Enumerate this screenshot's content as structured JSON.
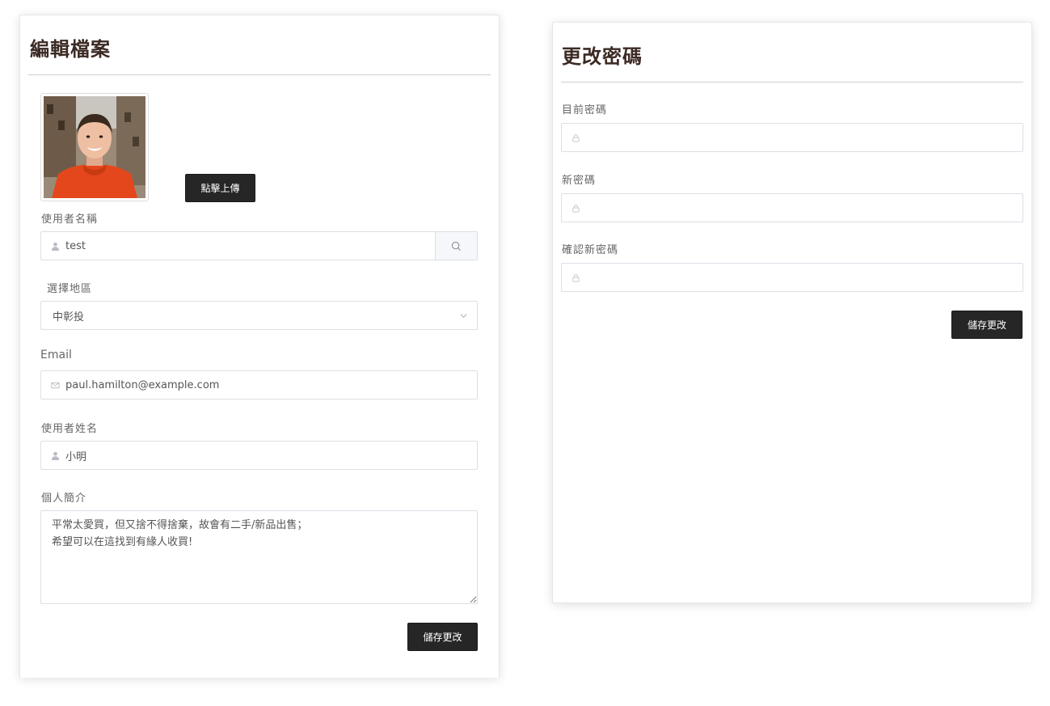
{
  "profile": {
    "title": "編輯檔案",
    "upload_label": "點擊上傳",
    "username": {
      "label": "使用者名稱",
      "value": "test",
      "icon": "user-icon",
      "append_icon": "search-icon"
    },
    "region": {
      "label": "選擇地區",
      "selected": "中彰投",
      "icon": "chevron-down-icon"
    },
    "email": {
      "label": "Email",
      "value": "paul.hamilton@example.com",
      "icon": "mail-icon"
    },
    "fullname": {
      "label": "使用者姓名",
      "value": "小明",
      "icon": "user-icon"
    },
    "bio": {
      "label": "個人簡介",
      "value": "平常太愛買，但又捨不得捨棄，故會有二手/新品出售；\n希望可以在這找到有緣人收買!"
    },
    "save_label": "儲存更改"
  },
  "password": {
    "title": "更改密碼",
    "current": {
      "label": "目前密碼",
      "icon": "lock-icon"
    },
    "new": {
      "label": "新密碼",
      "icon": "lock-icon"
    },
    "confirm": {
      "label": "確認新密碼",
      "icon": "lock-icon"
    },
    "save_label": "儲存更改"
  },
  "colors": {
    "button_bg": "#262626",
    "title": "#3b2a24",
    "border": "#dcdfe6"
  }
}
